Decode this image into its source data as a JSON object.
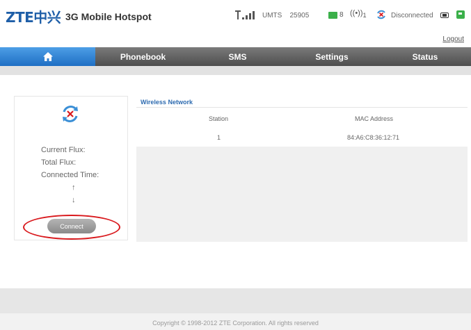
{
  "header": {
    "logo_text": "ZTE中兴",
    "product_name": "3G Mobile Hotspot",
    "network_type": "UMTS",
    "network_code": "25905",
    "sms_count": "8",
    "wifi_clients": "1",
    "connection_status": "Disconnected",
    "logout_label": "Logout"
  },
  "nav": {
    "items": [
      {
        "label": ""
      },
      {
        "label": "Phonebook"
      },
      {
        "label": "SMS"
      },
      {
        "label": "Settings"
      },
      {
        "label": "Status"
      }
    ]
  },
  "left_panel": {
    "current_flux_label": "Current Flux:",
    "total_flux_label": "Total Flux:",
    "connected_time_label": "Connected Time:",
    "up_arrow": "↑",
    "down_arrow": "↓",
    "connect_label": "Connect"
  },
  "wireless": {
    "title": "Wireless Network",
    "columns": [
      "Station",
      "MAC Address"
    ],
    "rows": [
      {
        "station": "1",
        "mac": "84:A6:C8:36:12:71"
      }
    ]
  },
  "footer": {
    "copyright": "Copyright © 1998-2012 ZTE Corporation. All rights reserved"
  },
  "colors": {
    "accent_blue": "#1f6fc4",
    "highlight_red": "#d9191d"
  }
}
